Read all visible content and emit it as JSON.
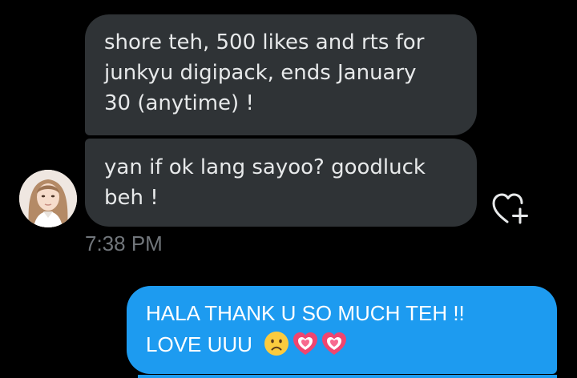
{
  "conversation": {
    "incoming": [
      {
        "text": "shore teh, 500 likes and rts for\njunkyu digipack, ends January\n30 (anytime) !"
      },
      {
        "text": "yan if ok lang sayoo? goodluck\nbeh !"
      }
    ],
    "timestamp": "7:38 PM",
    "outgoing": {
      "line1": "HALA THANK U SO MUCH TEH !!",
      "line2": "LOVE UUU",
      "emojis": [
        "frowning-face-emoji",
        "growing-heart-emoji",
        "growing-heart-emoji"
      ]
    }
  },
  "icons": {
    "reaction": "heart-plus-icon"
  },
  "colors": {
    "background": "#000000",
    "incoming_bubble": "#2f3336",
    "outgoing_bubble": "#1d9bf0",
    "timestamp": "#71767b",
    "icon": "#e7e9ea"
  }
}
